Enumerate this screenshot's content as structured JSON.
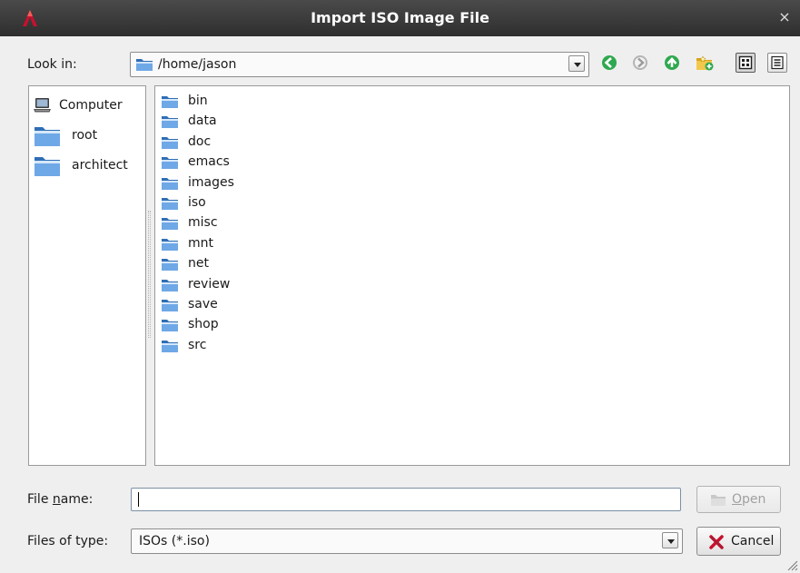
{
  "window": {
    "title": "Import ISO Image File",
    "close_symbol": "×"
  },
  "look_in": {
    "label": "Look in:",
    "path": "/home/jason"
  },
  "toolbar": {
    "icons": [
      "back-icon",
      "forward-icon",
      "up-icon",
      "new-folder-icon",
      "list-view-icon",
      "detail-view-icon"
    ]
  },
  "places": [
    {
      "label": "Computer",
      "icon": "computer-icon"
    },
    {
      "label": "root",
      "icon": "folder-icon"
    },
    {
      "label": "architect",
      "icon": "folder-icon"
    }
  ],
  "files": [
    "bin",
    "data",
    "doc",
    "emacs",
    "images",
    "iso",
    "misc",
    "mnt",
    "net",
    "review",
    "save",
    "shop",
    "src"
  ],
  "file_name": {
    "label_before": "File ",
    "label_mnemonic": "n",
    "label_after": "ame:",
    "value": ""
  },
  "file_type": {
    "label": "Files of type:",
    "value": "ISOs (*.iso)"
  },
  "buttons": {
    "open_mnemonic": "O",
    "open_rest": "pen",
    "cancel_label": "Cancel"
  },
  "colors": {
    "titlebar": "#3a3a3a",
    "folder": "#4a90d9",
    "nav_green": "#2fa84f",
    "accent_red": "#c8102e"
  }
}
